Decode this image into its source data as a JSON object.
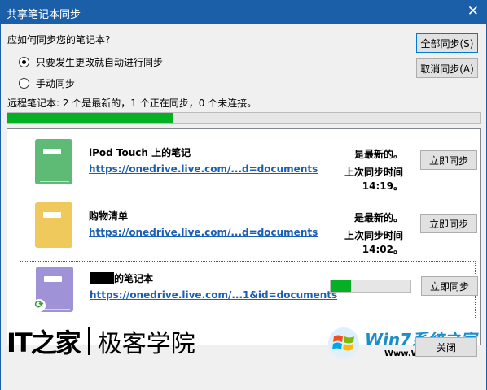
{
  "window": {
    "title": "共享笔记本同步",
    "close_glyph": "✕"
  },
  "question": "应如何同步您的笔记本?",
  "options": [
    {
      "label": "只要发生更改就自动进行同步",
      "checked": true
    },
    {
      "label": "手动同步",
      "checked": false
    }
  ],
  "buttons": {
    "sync_all": "全部同步(S)",
    "cancel_sync": "取消同步(A)",
    "close": "关闭"
  },
  "status": "远程笔记本: 2 个是最新的，1 个正在同步，0 个未连接。",
  "overall_progress_pct": 35,
  "notebooks": [
    {
      "name": "iPod Touch 上的笔记",
      "link": "https://onedrive.live.com/...d=documents",
      "state": "是最新的。",
      "last_sync": "上次同步时间 14:19。",
      "sync_label": "立即同步",
      "icon": "green-notebook-icon",
      "color": "#5dbb75"
    },
    {
      "name": "购物清单",
      "link": "https://onedrive.live.com/...d=documents",
      "state": "是最新的。",
      "last_sync": "上次同步时间 14:02。",
      "sync_label": "立即同步",
      "icon": "yellow-notebook-icon",
      "color": "#f0c95c"
    },
    {
      "name": "的笔记本",
      "link": "https://onedrive.live.com/...1&id=documents",
      "state": "",
      "last_sync": "",
      "sync_label": "立即同步",
      "icon": "purple-notebook-icon",
      "color": "#9f92d6",
      "progress_pct": 25
    }
  ],
  "watermark_left": {
    "logo": "IT之家",
    "text": "极客学院"
  },
  "watermark_right": {
    "brand": "Win7系统之家",
    "url": "Www.Winwin7.com"
  }
}
